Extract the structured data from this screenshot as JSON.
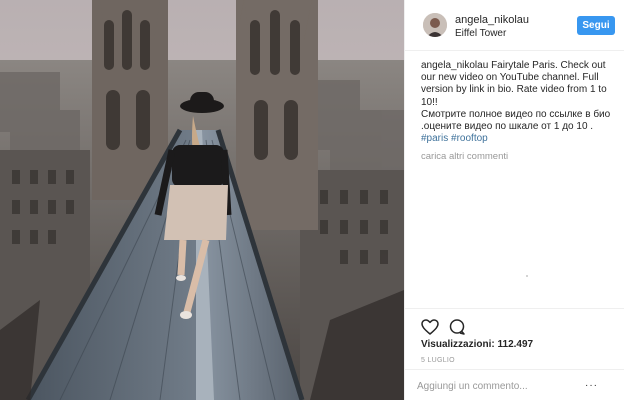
{
  "post": {
    "username": "angela_nikolau",
    "location": "Eiffel Tower",
    "follow_label": "Segui"
  },
  "caption": {
    "author": "angela_nikolau",
    "text_en": "Fairytale Paris. Check out our new video on YouTube channel. Full version by link in bio. Rate video from 1 to 10!!",
    "text_ru": "Смотрите полное видео по ссылке в био .оцените видео по шкале от 1 до 10 .",
    "hashtags": [
      "#paris",
      "#rooftop"
    ],
    "load_more": "carica altri commenti"
  },
  "stats": {
    "views_label": "Visualizzazioni: 112.497",
    "date": "5 LUGLIO"
  },
  "comment": {
    "placeholder": "Aggiungi un commento...",
    "more_label": "···"
  },
  "icons": {
    "like": "heart-icon",
    "comment": "comment-bubble-icon",
    "more": "more-dots-icon"
  },
  "colors": {
    "follow_button": "#3897f0",
    "hashtag": "#3f729b",
    "muted_text": "#999999"
  }
}
